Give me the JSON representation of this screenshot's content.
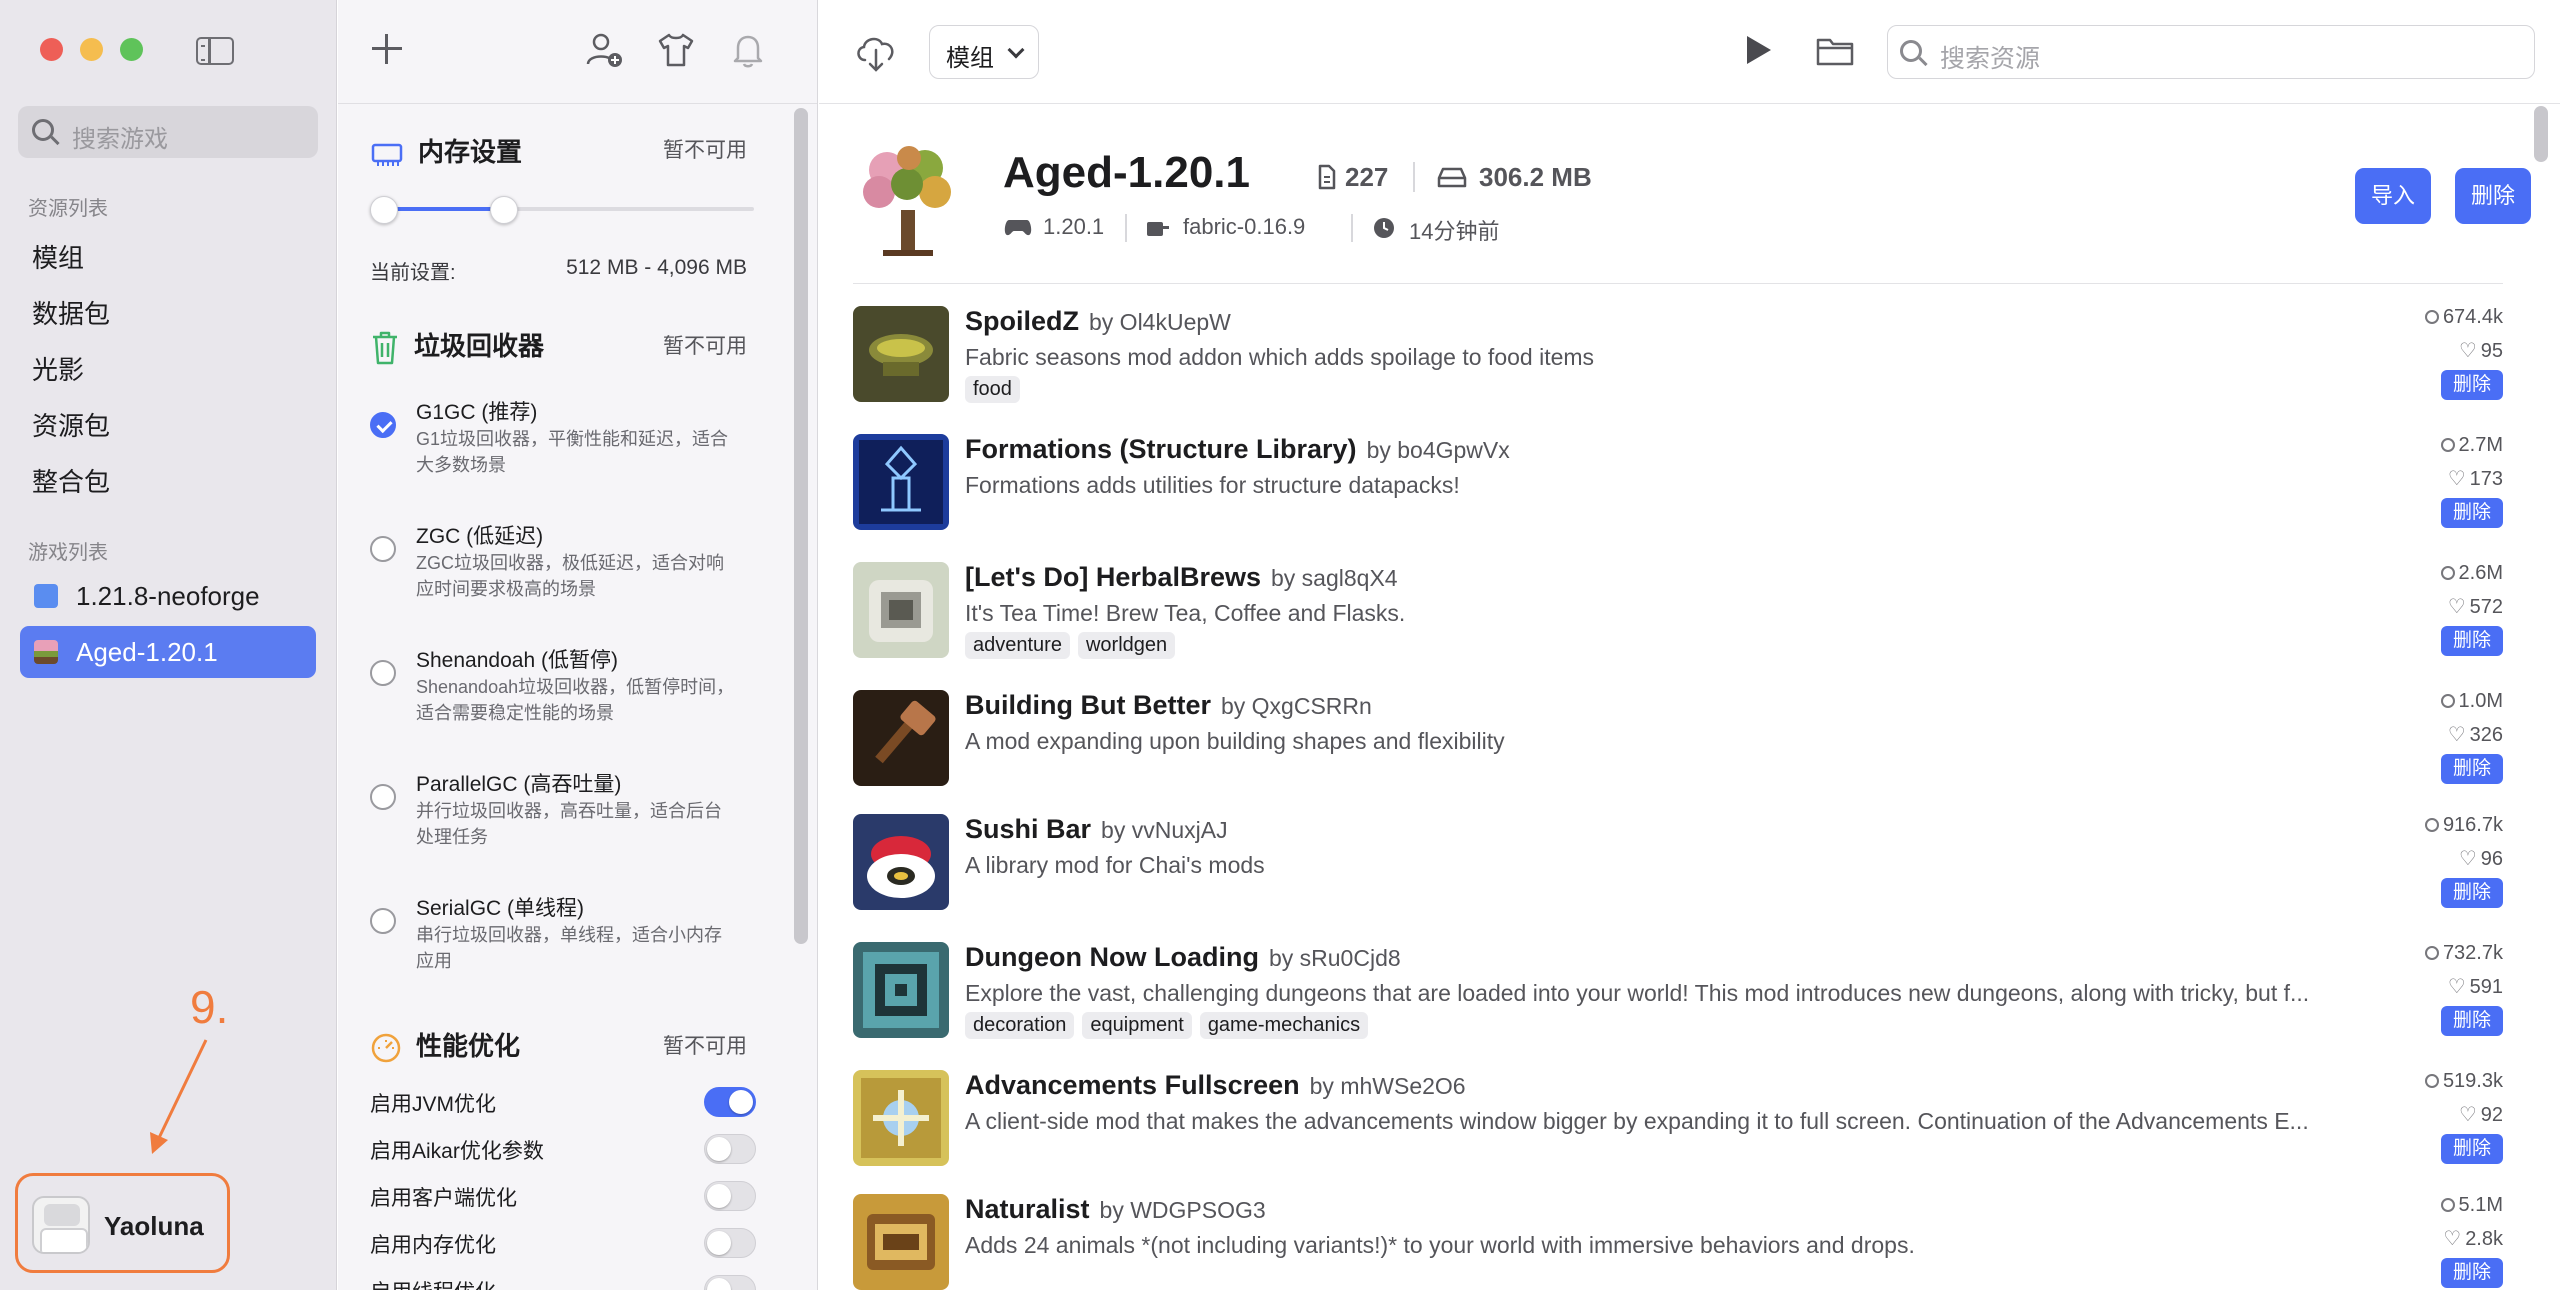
{
  "sidebar": {
    "search_placeholder": "搜索游戏",
    "resources_section": "资源列表",
    "resources": [
      "模组",
      "数据包",
      "光影",
      "资源包",
      "整合包"
    ],
    "games_section": "游戏列表",
    "games": [
      {
        "label": "1.21.8-neoforge",
        "selected": false
      },
      {
        "label": "Aged-1.20.1",
        "selected": true
      }
    ],
    "annotation_number": "9.",
    "user_name": "Yaoluna"
  },
  "settings": {
    "memory": {
      "title": "内存设置",
      "status": "暂不可用",
      "current_label": "当前设置:",
      "current_value": "512 MB - 4,096 MB"
    },
    "gc": {
      "title": "垃圾回收器",
      "status": "暂不可用",
      "options": [
        {
          "title": "G1GC (推荐)",
          "desc": "G1垃圾回收器，平衡性能和延迟，适合大多数场景",
          "selected": true
        },
        {
          "title": "ZGC (低延迟)",
          "desc": "ZGC垃圾回收器，极低延迟，适合对响应时间要求极高的场景",
          "selected": false
        },
        {
          "title": "Shenandoah (低暂停)",
          "desc": "Shenandoah垃圾回收器，低暂停时间，适合需要稳定性能的场景",
          "selected": false
        },
        {
          "title": "ParallelGC (高吞吐量)",
          "desc": "并行垃圾回收器，高吞吐量，适合后台处理任务",
          "selected": false
        },
        {
          "title": "SerialGC (单线程)",
          "desc": "串行垃圾回收器，单线程，适合小内存应用",
          "selected": false
        }
      ]
    },
    "perf": {
      "title": "性能优化",
      "status": "暂不可用",
      "rows": [
        {
          "label": "启用JVM优化",
          "on": true
        },
        {
          "label": "启用Aikar优化参数",
          "on": false
        },
        {
          "label": "启用客户端优化",
          "on": false
        },
        {
          "label": "启用内存优化",
          "on": false
        },
        {
          "label": "启用线程优化",
          "on": false
        }
      ]
    }
  },
  "toolbar": {
    "type_select": "模组",
    "search_placeholder": "搜索资源"
  },
  "game": {
    "title": "Aged-1.20.1",
    "files": "227",
    "size": "306.2 MB",
    "version": "1.20.1",
    "loader": "fabric-0.16.9",
    "time": "14分钟前",
    "import_label": "导入",
    "delete_label": "删除"
  },
  "mods": [
    {
      "name": "SpoiledZ",
      "author": "by Ol4kUepW",
      "desc": "Fabric seasons mod addon which adds spoilage to food items",
      "tags": [
        "food"
      ],
      "downloads": "674.4k",
      "likes": "95",
      "delete": "删除"
    },
    {
      "name": "Formations (Structure Library)",
      "author": "by bo4GpwVx",
      "desc": "Formations adds utilities for structure datapacks!",
      "tags": [],
      "downloads": "2.7M",
      "likes": "173",
      "delete": "删除"
    },
    {
      "name": "[Let's Do] HerbalBrews",
      "author": "by sagl8qX4",
      "desc": "It's Tea Time! Brew Tea, Coffee and Flasks.",
      "tags": [
        "adventure",
        "worldgen"
      ],
      "downloads": "2.6M",
      "likes": "572",
      "delete": "删除"
    },
    {
      "name": "Building But Better",
      "author": "by QxgCSRRn",
      "desc": "A mod expanding upon building shapes and flexibility",
      "tags": [],
      "downloads": "1.0M",
      "likes": "326",
      "delete": "删除"
    },
    {
      "name": "Sushi Bar",
      "author": "by vvNuxjAJ",
      "desc": "A library mod for Chai's mods",
      "tags": [],
      "downloads": "916.7k",
      "likes": "96",
      "delete": "删除"
    },
    {
      "name": "Dungeon Now Loading",
      "author": "by sRu0Cjd8",
      "desc": "Explore the vast, challenging dungeons that are loaded into your world! This mod introduces new dungeons, along with tricky, but f...",
      "tags": [
        "decoration",
        "equipment",
        "game-mechanics"
      ],
      "downloads": "732.7k",
      "likes": "591",
      "delete": "删除"
    },
    {
      "name": "Advancements Fullscreen",
      "author": "by mhWSe2O6",
      "desc": "A client-side mod that makes the advancements window bigger by expanding it to full screen. Continuation of the Advancements E...",
      "tags": [],
      "downloads": "519.3k",
      "likes": "92",
      "delete": "删除"
    },
    {
      "name": "Naturalist",
      "author": "by WDGPSOG3",
      "desc": "Adds 24 animals *(not including variants!)* to your world with immersive behaviors and drops.",
      "tags": [],
      "downloads": "5.1M",
      "likes": "2.8k",
      "delete": "删除"
    }
  ]
}
